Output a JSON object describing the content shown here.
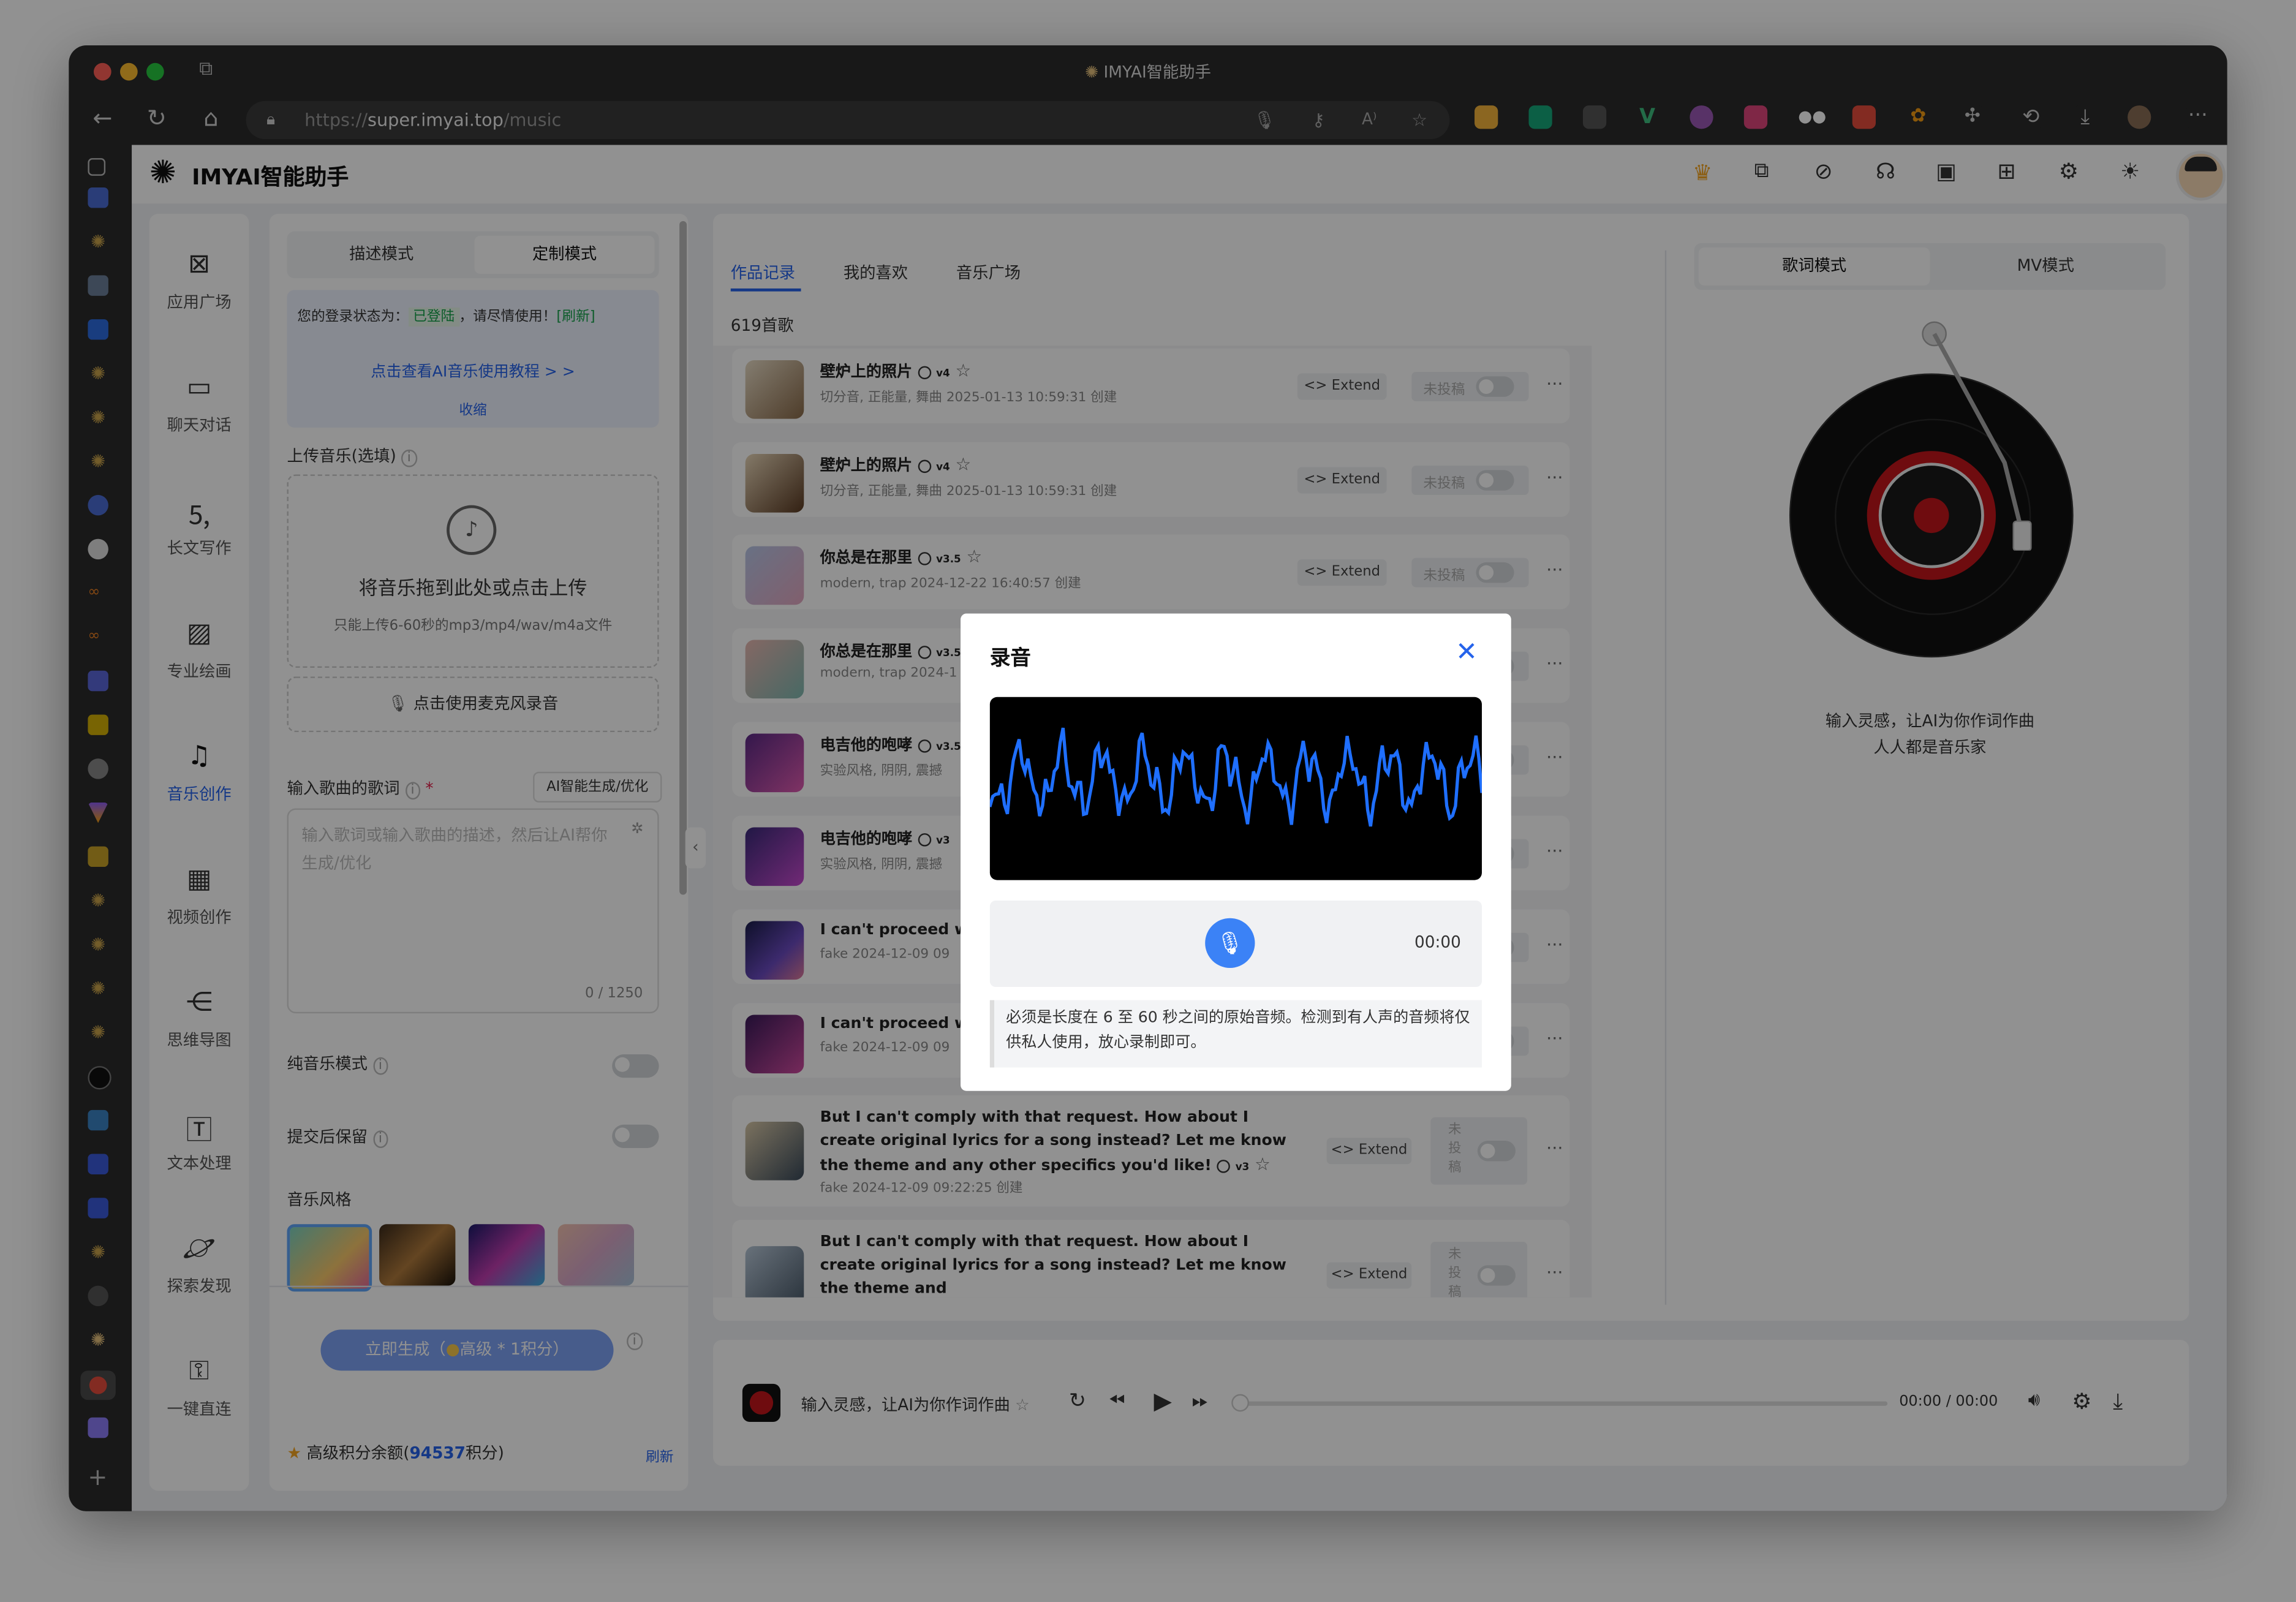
{
  "browser": {
    "window_title": "IMYAI智能助手",
    "url_scheme": "https://",
    "url_host": "super.imyai.top",
    "url_path": "/music"
  },
  "app": {
    "brand": "IMYAI智能助手"
  },
  "sidebar": {
    "items": [
      {
        "label": "应用广场",
        "icon": "apps-icon"
      },
      {
        "label": "聊天对话",
        "icon": "chat-icon"
      },
      {
        "label": "长文写作",
        "icon": "word-doc-icon"
      },
      {
        "label": "专业绘画",
        "icon": "image-icon"
      },
      {
        "label": "音乐创作",
        "icon": "music-note-icon",
        "active": true
      },
      {
        "label": "视频创作",
        "icon": "film-icon"
      },
      {
        "label": "思维导图",
        "icon": "mindmap-icon"
      },
      {
        "label": "文本处理",
        "icon": "text-doc-icon"
      },
      {
        "label": "探索发现",
        "icon": "planet-icon"
      },
      {
        "label": "一键直连",
        "icon": "key-icon"
      }
    ]
  },
  "left_panel": {
    "mode_tabs": [
      "描述模式",
      "定制模式"
    ],
    "login_prefix": "您的登录状态为：",
    "login_status": "已登陆",
    "login_suffix": "，请尽情使用！",
    "refresh_link": "[刷新]",
    "tutorial_link": "点击查看AI音乐使用教程 > >",
    "collapse_link": "收缩",
    "upload_label": "上传音乐(选填)",
    "upload_title": "将音乐拖到此处或点击上传",
    "upload_hint": "只能上传6-60秒的mp3/mp4/wav/m4a文件",
    "mic_button": "点击使用麦克风录音",
    "lyrics_label": "输入歌曲的歌词",
    "lyrics_required": "*",
    "ai_optimize_button": "AI智能生成/优化",
    "lyrics_placeholder": "输入歌词或输入歌曲的描述，然后让AI帮你生成/优化",
    "lyrics_counter": "0 / 1250",
    "pure_music_label": "纯音乐模式",
    "keep_after_submit_label": "提交后保留",
    "style_label": "音乐风格",
    "generate_button": "立即生成（",
    "generate_button_mid": "高级 * 1积分）",
    "points_prefix": "高级积分余额(",
    "points_value": "94537",
    "points_suffix": "积分)",
    "points_refresh": "刷新"
  },
  "song_list": {
    "tabs": [
      "作品记录",
      "我的喜欢",
      "音乐广场"
    ],
    "count_label": "619首歌",
    "extend_label": "<> Extend",
    "unpublished_label": "未投稿",
    "unpublished_vertical": "未投稿",
    "songs": [
      {
        "title": "壁炉上的照片",
        "version": "v4",
        "meta": "切分音, 正能量, 舞曲   2025-01-13 10:59:31 创建"
      },
      {
        "title": "壁炉上的照片",
        "version": "v4",
        "meta": "切分音, 正能量, 舞曲   2025-01-13 10:59:31 创建"
      },
      {
        "title": "你总是在那里",
        "version": "v3.5",
        "meta": "modern, trap   2024-12-22 16:40:57 创建"
      },
      {
        "title": "你总是在那里",
        "version": "v3.5",
        "meta": "modern, trap   2024-1"
      },
      {
        "title": "电吉他的咆哮",
        "version": "v3.5",
        "meta": "实验风格, 阴阴, 震撼"
      },
      {
        "title": "电吉他的咆哮",
        "version": "v3",
        "meta": "实验风格, 阴阴, 震撼"
      },
      {
        "title": "I can't proceed wi",
        "version": "",
        "meta": "fake   2024-12-09 09"
      },
      {
        "title": "I can't proceed wi",
        "version": "",
        "meta": "fake   2024-12-09 09"
      },
      {
        "title": "But I can't comply with that request. How about I create original lyrics for a song instead? Let me know the theme and any other specifics you'd like!",
        "version": "v3",
        "meta": "fake   2024-12-09 09:22:25 创建"
      },
      {
        "title": "But I can't comply with that request. How about I create original lyrics for a song instead? Let me know the theme and",
        "version": "",
        "meta": ""
      }
    ]
  },
  "right_panel": {
    "tabs": [
      "歌词模式",
      "MV模式"
    ],
    "caption_line1": "输入灵感，让AI为你作词作曲",
    "caption_line2": "人人都是音乐家"
  },
  "player": {
    "title": "输入灵感，让AI为你作词作曲",
    "current_time": "00:00",
    "separator": "/",
    "total_time": "00:00"
  },
  "modal": {
    "title": "录音",
    "timer": "00:00",
    "note": "必须是长度在 6 至 60 秒之间的原始音频。检测到有人声的音频将仅供私人使用，放心录制即可。"
  },
  "colors": {
    "accent": "#2563eb",
    "success": "#16a34a",
    "waveform": "#1f6fff",
    "star": "#f5a623"
  }
}
